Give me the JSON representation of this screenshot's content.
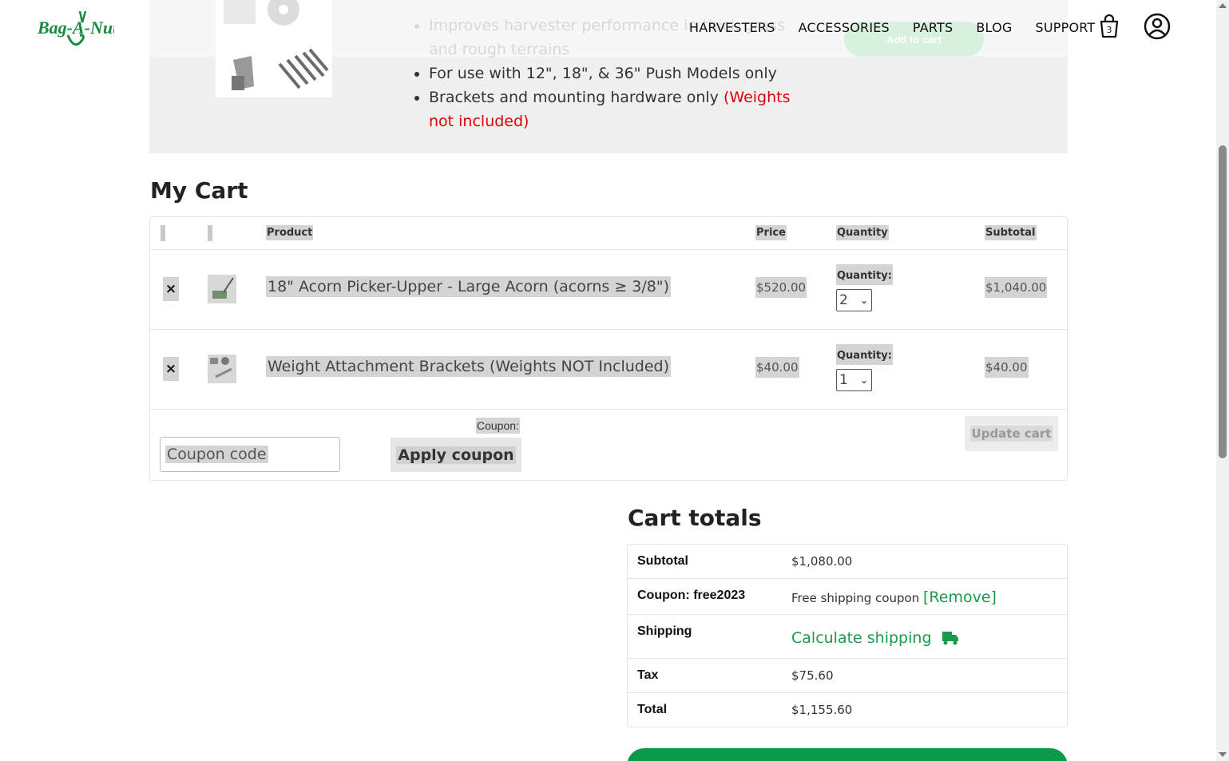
{
  "header": {
    "logo_text": "Bag-A-Nut",
    "nav": [
      "HARVESTERS",
      "ACCESSORIES",
      "PARTS",
      "BLOG",
      "SUPPORT"
    ],
    "cart_count": "3"
  },
  "product_strip": {
    "bullets": [
      {
        "text": "Improves harvester performance in thick grass and rough terrains",
        "red": ""
      },
      {
        "text": "For use with 12\", 18\", & 36\" Push Models only",
        "red": ""
      },
      {
        "text": "Brackets and mounting hardware only ",
        "red": "(Weights not included)"
      }
    ],
    "add_to_cart_label": "Add to cart"
  },
  "cart": {
    "title": "My Cart",
    "columns": {
      "product": "Product",
      "price": "Price",
      "quantity": "Quantity",
      "subtotal": "Subtotal"
    },
    "items": [
      {
        "remove": "×",
        "name": "18\" Acorn Picker-Upper - Large Acorn (acorns ≥ 3/8\")",
        "price": "$520.00",
        "qty_label": "Quantity:",
        "qty": "2",
        "subtotal": "$1,040.00"
      },
      {
        "remove": "×",
        "name": "Weight Attachment Brackets (Weights NOT Included)",
        "price": "$40.00",
        "qty_label": "Quantity:",
        "qty": "1",
        "subtotal": "$40.00"
      }
    ],
    "coupon_label": "Coupon:",
    "coupon_placeholder": "Coupon code",
    "apply_label": "Apply coupon",
    "update_label": "Update cart"
  },
  "totals": {
    "title": "Cart totals",
    "subtotal_label": "Subtotal",
    "subtotal_value": "$1,080.00",
    "coupon_label": "Coupon: free2023",
    "coupon_value": "Free shipping coupon",
    "coupon_remove": "[Remove]",
    "shipping_label": "Shipping",
    "shipping_link": "Calculate shipping",
    "tax_label": "Tax",
    "tax_value": "$75.60",
    "total_label": "Total",
    "total_value": "$1,155.60"
  },
  "colors": {
    "brand_green": "#0d9a48",
    "link_green": "#1a9a4b",
    "alert_red": "#e00000"
  }
}
